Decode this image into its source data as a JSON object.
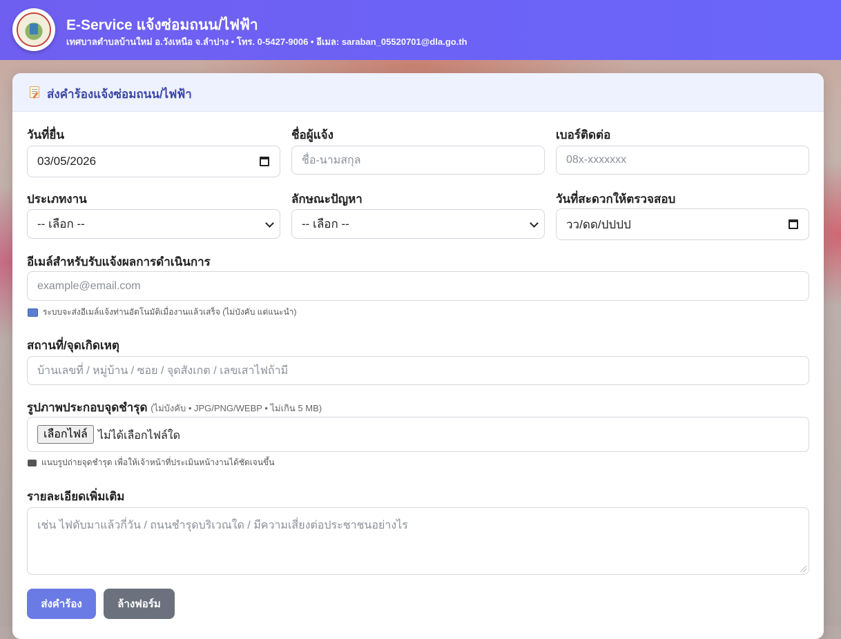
{
  "header": {
    "title": "E-Service แจ้งซ่อมถนน/ไฟฟ้า",
    "subtitle": "เทศบาลตำบลบ้านใหม่ อ.วังเหนือ จ.ลำปาง • โทร. 0-5427-9006 • อีเมล: saraban_05520701@dla.go.th",
    "logo_icon": "municipality-seal-icon"
  },
  "form": {
    "heading": "ส่งคำร้องแจ้งซ่อมถนน/ไฟฟ้า",
    "heading_icon": "memo-icon",
    "date_label": "วันที่ยื่น",
    "date_value": "03/05/2026",
    "name_label": "ชื่อผู้แจ้ง",
    "name_placeholder": "ชื่อ-นามสกุล",
    "phone_label": "เบอร์ติดต่อ",
    "phone_placeholder": "08x-xxxxxxx",
    "type_label": "ประเภทงาน",
    "type_value": "-- เลือก --",
    "issue_label": "ลักษณะปัญหา",
    "issue_value": "-- เลือก --",
    "inspect_label": "วันที่สะดวกให้ตรวจสอบ",
    "inspect_value": "วว/ดด/ปปปป",
    "email_label": "อีเมล์สำหรับรับแจ้งผลการดำเนินการ",
    "email_placeholder": "example@email.com",
    "email_hint": "ระบบจะส่งอีเมล์แจ้งท่านอัตโนมัติเมื่องานแล้วเสร็จ (ไม่บังคับ แต่แนะนำ)",
    "location_label": "สถานที่/จุดเกิดเหตุ",
    "location_placeholder": "บ้านเลขที่ / หมู่บ้าน / ซอย / จุดสังเกต / เลขเสาไฟถ้ามี",
    "photo_label": "รูปภาพประกอบจุดชำรุด",
    "photo_note": "(ไม่บังคับ • JPG/PNG/WEBP • ไม่เกิน 5 MB)",
    "file_button": "เลือกไฟล์",
    "file_status": "ไม่ได้เลือกไฟล์ใด",
    "photo_hint": "แนบรูปถ่ายจุดชำรุด เพื่อให้เจ้าหน้าที่ประเมินหน้างานได้ชัดเจนขึ้น",
    "details_label": "รายละเอียดเพิ่มเติม",
    "details_placeholder": "เช่น ไฟดับมาแล้วกี่วัน / ถนนชำรุดบริเวณใด / มีความเสี่ยงต่อประชาชนอย่างไร",
    "submit_label": "ส่งคำร้อง",
    "reset_label": "ล้างฟอร์ม"
  },
  "colors": {
    "header": "#6c62f6",
    "accent": "#3b47a6",
    "primary_button": "#6b7be5",
    "secondary_button": "#6b717d"
  }
}
